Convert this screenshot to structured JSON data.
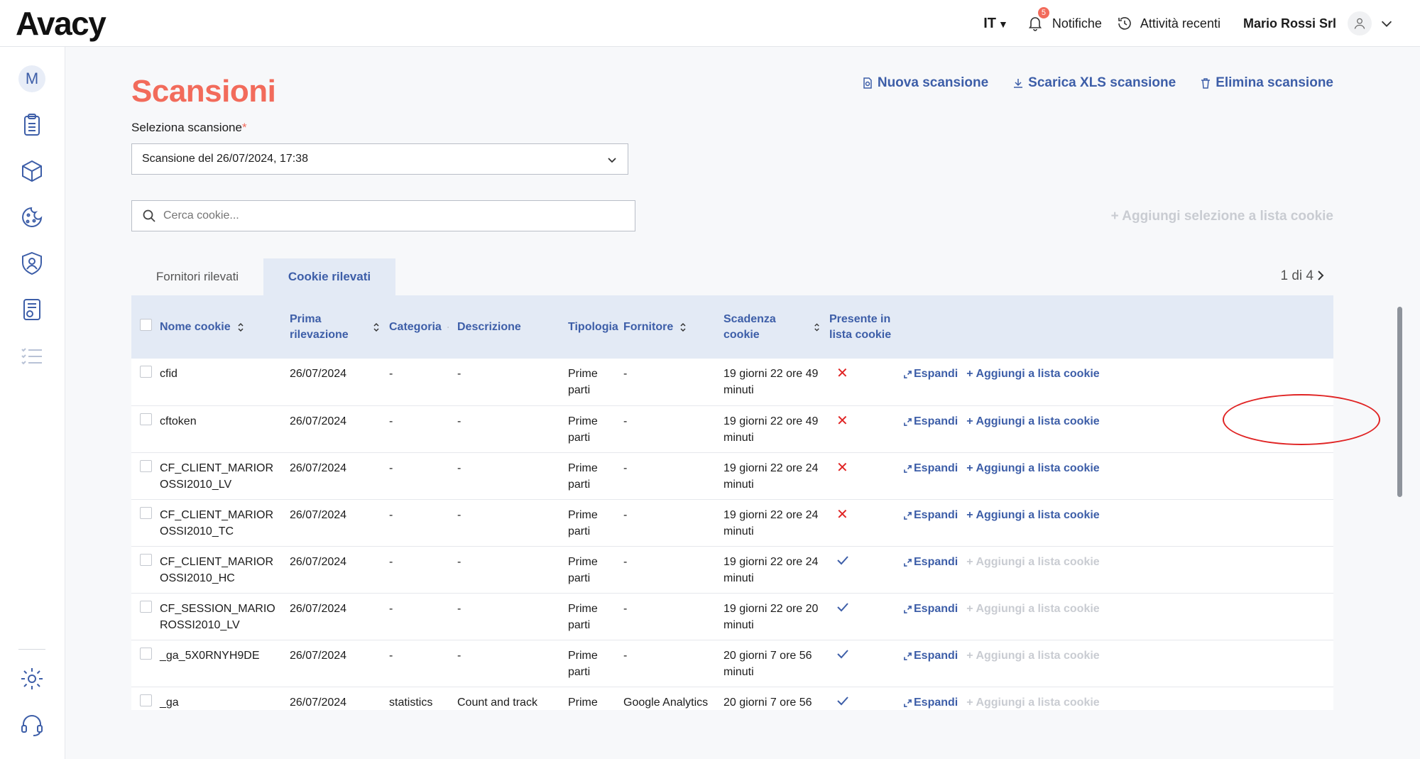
{
  "brand": {
    "logo": "Avacy"
  },
  "topbar": {
    "lang": "IT",
    "notifications_count": "5",
    "notifications_label": "Notifiche",
    "recent_label": "Attività recenti",
    "user_name": "Mario Rossi Srl"
  },
  "sidebar": {
    "avatar_initial": "M"
  },
  "page": {
    "title": "Scansioni",
    "actions": {
      "new_scan": "Nuova scansione",
      "download_xls": "Scarica XLS scansione",
      "delete_scan": "Elimina scansione"
    },
    "select_label": "Seleziona scansione",
    "select_required": "*",
    "select_value": "Scansione del 26/07/2024, 17:38",
    "search_placeholder": "Cerca cookie...",
    "add_selection": "Aggiungi selezione a lista cookie",
    "tabs": [
      {
        "label": "Fornitori rilevati",
        "active": false
      },
      {
        "label": "Cookie rilevati",
        "active": true
      }
    ],
    "pager": "1 di 4"
  },
  "table": {
    "headers": {
      "name": "Nome cookie",
      "first": "Prima rilevazione",
      "category": "Categoria",
      "description": "Descrizione",
      "type": "Tipologia",
      "provider": "Fornitore",
      "expiry": "Scadenza cookie",
      "present": "Presente in lista cookie"
    },
    "expand_label": "Espandi",
    "add_label": "Aggiungi a lista cookie",
    "rows": [
      {
        "name": "cfid",
        "first": "26/07/2024",
        "category": "-",
        "description": "-",
        "type": "Prime parti",
        "provider": "-",
        "expiry": "19 giorni 22 ore 49 minuti",
        "present": false
      },
      {
        "name": "cftoken",
        "first": "26/07/2024",
        "category": "-",
        "description": "-",
        "type": "Prime parti",
        "provider": "-",
        "expiry": "19 giorni 22 ore 49 minuti",
        "present": false
      },
      {
        "name": "CF_CLIENT_MARIOROSSI2010_LV",
        "first": "26/07/2024",
        "category": "-",
        "description": "-",
        "type": "Prime parti",
        "provider": "-",
        "expiry": "19 giorni 22 ore 24 minuti",
        "present": false
      },
      {
        "name": "CF_CLIENT_MARIOROSSI2010_TC",
        "first": "26/07/2024",
        "category": "-",
        "description": "-",
        "type": "Prime parti",
        "provider": "-",
        "expiry": "19 giorni 22 ore 24 minuti",
        "present": false
      },
      {
        "name": "CF_CLIENT_MARIOROSSI2010_HC",
        "first": "26/07/2024",
        "category": "-",
        "description": "-",
        "type": "Prime parti",
        "provider": "-",
        "expiry": "19 giorni 22 ore 24 minuti",
        "present": true
      },
      {
        "name": "CF_SESSION_MARIOROSSI2010_LV",
        "first": "26/07/2024",
        "category": "-",
        "description": "-",
        "type": "Prime parti",
        "provider": "-",
        "expiry": "19 giorni 22 ore 20 minuti",
        "present": true
      },
      {
        "name": "_ga_5X0RNYH9DE",
        "first": "26/07/2024",
        "category": "-",
        "description": "-",
        "type": "Prime parti",
        "provider": "-",
        "expiry": "20 giorni 7 ore 56 minuti",
        "present": true
      },
      {
        "name": "_ga",
        "first": "26/07/2024",
        "category": "statistics",
        "description": "Count and track",
        "type": "Prime",
        "provider": "Google Analytics",
        "expiry": "20 giorni 7 ore 56",
        "present": true
      }
    ]
  }
}
